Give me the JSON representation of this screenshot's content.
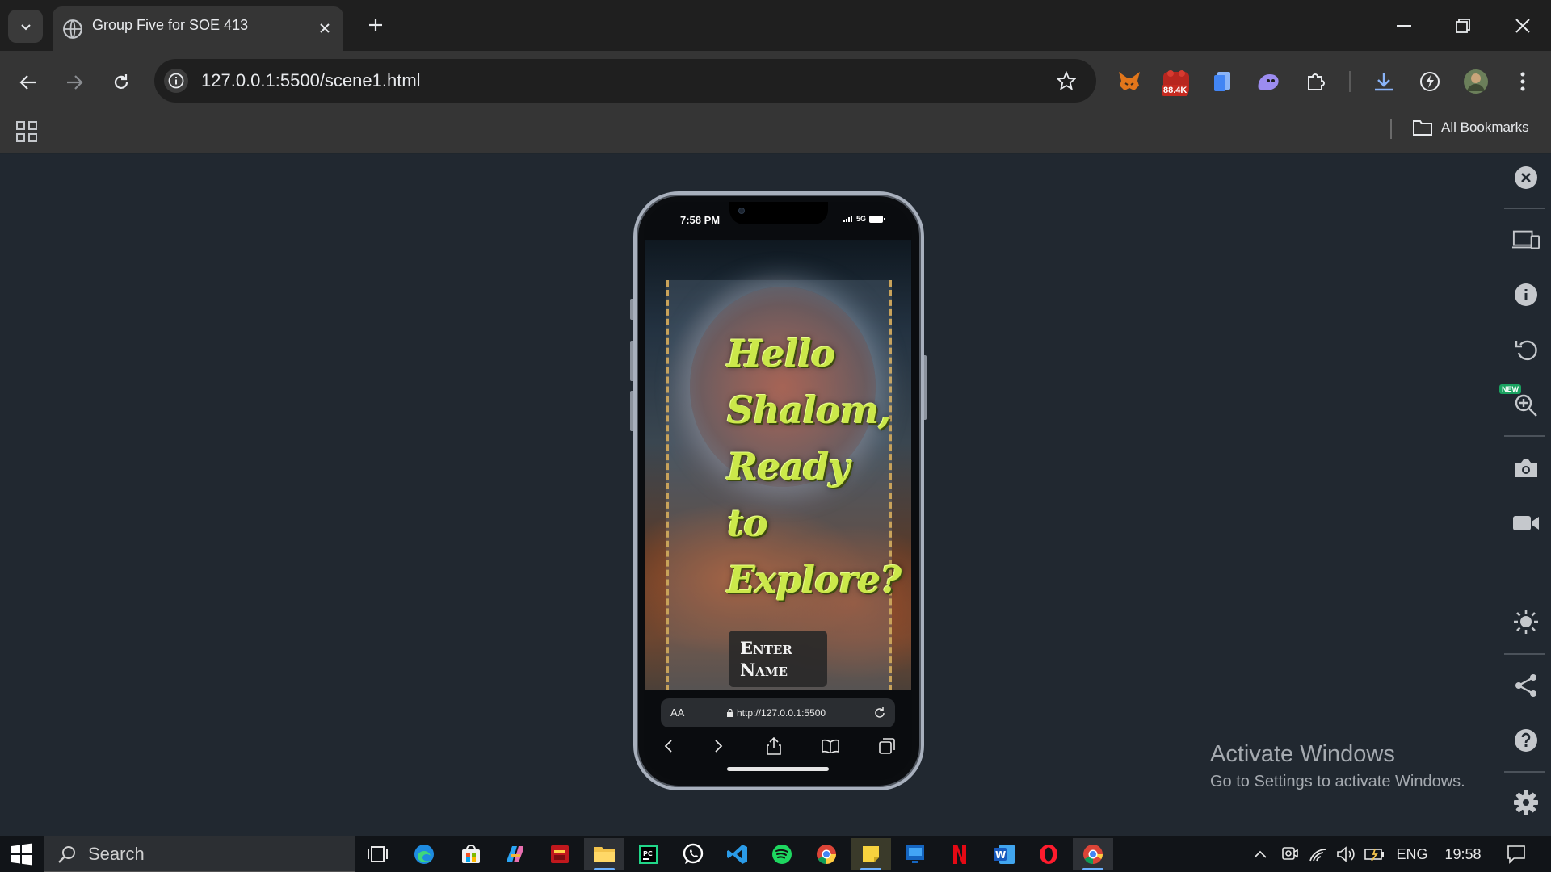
{
  "browser": {
    "tab_title": "Group Five for SOE 413",
    "url": "127.0.0.1:5500/scene1.html",
    "all_bookmarks_label": "All Bookmarks",
    "extension_badge": "88.4K"
  },
  "device": {
    "status_time": "7:58 PM",
    "network": "5G",
    "page": {
      "greeting_lines": [
        "Hello",
        "Shalom,",
        "Ready",
        "to",
        "Explore?"
      ],
      "button_line1": "Enter",
      "button_line2": "Name"
    },
    "safari": {
      "text_size_label": "AA",
      "url": "http://127.0.0.1:5500"
    }
  },
  "sidebar": {
    "new_badge": "NEW"
  },
  "watermark": {
    "title": "Activate Windows",
    "subtitle": "Go to Settings to activate Windows."
  },
  "taskbar": {
    "search_placeholder": "Search",
    "language": "ENG",
    "clock": "19:58"
  }
}
